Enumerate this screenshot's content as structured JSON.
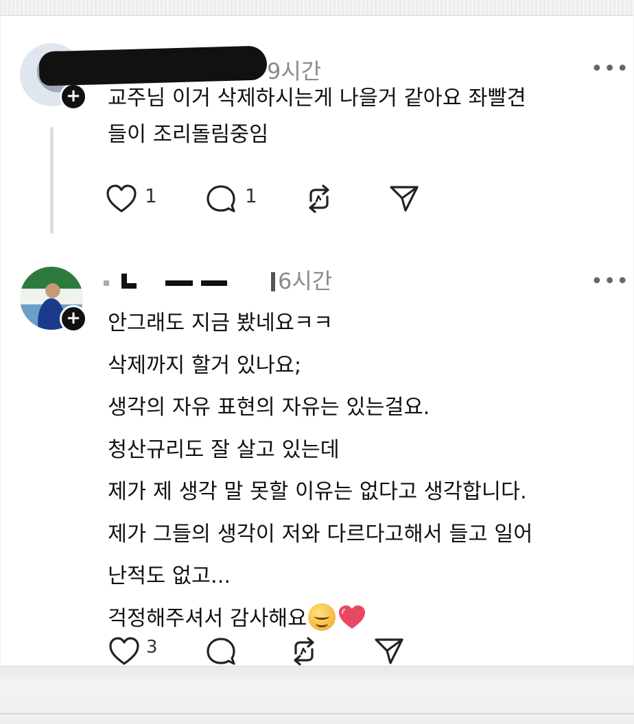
{
  "posts": [
    {
      "time": "9시간",
      "text": "교주님 이거 삭제하시는게 나을거 같아요 좌빨견\n들이 조리돌림중임",
      "like_count": "1",
      "reply_count": "1",
      "repost_count": "",
      "avatar": "user-photo-avatar"
    },
    {
      "time": "6시간",
      "text": "안그래도 지금 봤네요ㅋㅋ\n삭제까지 할거 있나요;\n생각의 자유 표현의 자유는 있는걸요.\n청산규리도 잘 살고 있는데\n제가 제 생각 말 못할 이유는 없다고 생각합니다.\n제가 그들의 생각이 저와 다르다고해서 들고 일어\n난적도 없고...\n걱정해주셔서 감사해요",
      "emojis": [
        "smiling-face-emoji",
        "red-heart-emoji"
      ],
      "like_count": "3",
      "reply_count": "",
      "repost_count": "",
      "avatar": "user-photo-avatar"
    }
  ],
  "icons": {
    "more": "more-horizontal-icon",
    "follow": "plus-icon",
    "like": "heart-outline-icon",
    "reply": "speech-bubble-icon",
    "repost": "repost-arrows-icon",
    "share": "send-paper-plane-icon"
  },
  "colors": {
    "text": "#111111",
    "muted": "#8a8a8a",
    "heart_emoji": "#e8485f"
  }
}
